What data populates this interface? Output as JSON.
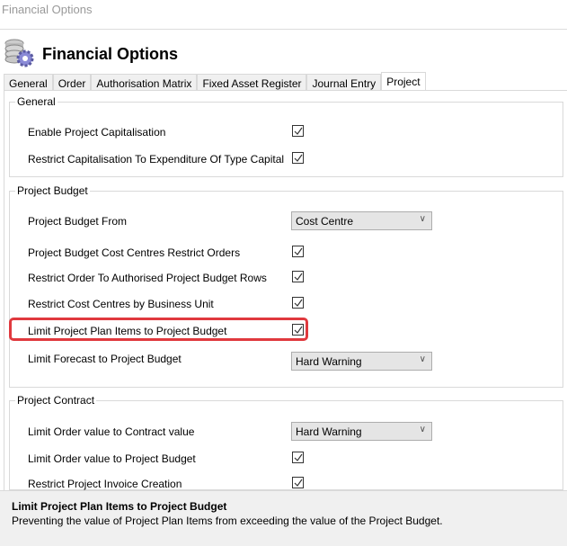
{
  "window_title": "Financial Options",
  "header": {
    "title": "Financial Options",
    "icon": "coins-gear-icon"
  },
  "tabs": [
    {
      "label": "General"
    },
    {
      "label": "Order"
    },
    {
      "label": "Authorisation Matrix"
    },
    {
      "label": "Fixed Asset Register"
    },
    {
      "label": "Journal Entry"
    },
    {
      "label": "Project",
      "active": true
    }
  ],
  "groups": {
    "general": {
      "title": "General",
      "rows": [
        {
          "label": "Enable Project Capitalisation",
          "checked": true
        },
        {
          "label": "Restrict Capitalisation To Expenditure Of Type Capital",
          "checked": true
        }
      ]
    },
    "budget": {
      "title": "Project Budget",
      "rows": [
        {
          "label": "Project Budget From",
          "value": "Cost Centre"
        },
        {
          "label": "Project Budget Cost Centres Restrict Orders",
          "checked": true
        },
        {
          "label": "Restrict Order To Authorised Project Budget Rows",
          "checked": true
        },
        {
          "label": "Restrict Cost Centres by Business Unit",
          "checked": true
        },
        {
          "label": "Limit Project Plan Items to Project Budget",
          "checked": true,
          "highlighted": true
        },
        {
          "label": "Limit Forecast to Project Budget",
          "value": "Hard Warning"
        }
      ]
    },
    "contract": {
      "title": "Project Contract",
      "rows": [
        {
          "label": "Limit Order value to Contract value",
          "value": "Hard Warning"
        },
        {
          "label": "Limit Order value to Project Budget",
          "checked": true
        },
        {
          "label": "Restrict Project Invoice Creation",
          "checked": true
        }
      ]
    }
  },
  "footer": {
    "title": "Limit Project Plan Items to Project Budget",
    "description": "Preventing the value of Project Plan Items from exceeding the value of the Project Budget."
  },
  "highlight_color": "#e0393e"
}
